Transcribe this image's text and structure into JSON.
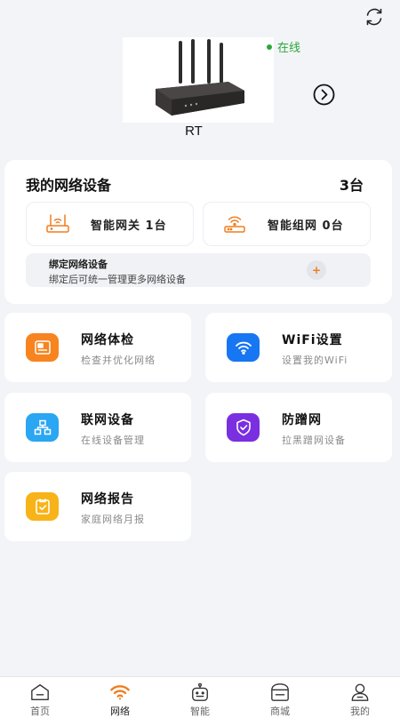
{
  "device": {
    "status": "在线",
    "name": "RT"
  },
  "my_devices": {
    "title": "我的网络设备",
    "count": "3台",
    "gateway_label": "智能网关 1台",
    "mesh_label": "智能组网 0台",
    "bind_title": "绑定网络设备",
    "bind_desc": "绑定后可统一管理更多网络设备",
    "bind_add_symbol": "+"
  },
  "features": [
    {
      "title": "网络体检",
      "subtitle": "检查并优化网络",
      "icon": "checkup-icon",
      "color": "#f7841f"
    },
    {
      "title": "WiFi设置",
      "subtitle": "设置我的WiFi",
      "icon": "wifi-settings-icon",
      "color": "#1776f2"
    },
    {
      "title": "联网设备",
      "subtitle": "在线设备管理",
      "icon": "network-devices-icon",
      "color": "#2aa6f2"
    },
    {
      "title": "防蹭网",
      "subtitle": "拉黑蹭网设备",
      "icon": "shield-icon",
      "color": "#7a2fe0"
    },
    {
      "title": "网络报告",
      "subtitle": "家庭网络月报",
      "icon": "report-icon",
      "color": "#f7b318"
    }
  ],
  "tabbar": {
    "items": [
      {
        "label": "首页",
        "icon": "home-icon"
      },
      {
        "label": "网络",
        "icon": "network-icon",
        "active": true
      },
      {
        "label": "智能",
        "icon": "robot-icon"
      },
      {
        "label": "商城",
        "icon": "store-icon"
      },
      {
        "label": "我的",
        "icon": "profile-icon"
      }
    ]
  },
  "colors": {
    "online": "#2aa838",
    "accent_orange": "#f07d1e",
    "background": "#f3f4f8"
  }
}
